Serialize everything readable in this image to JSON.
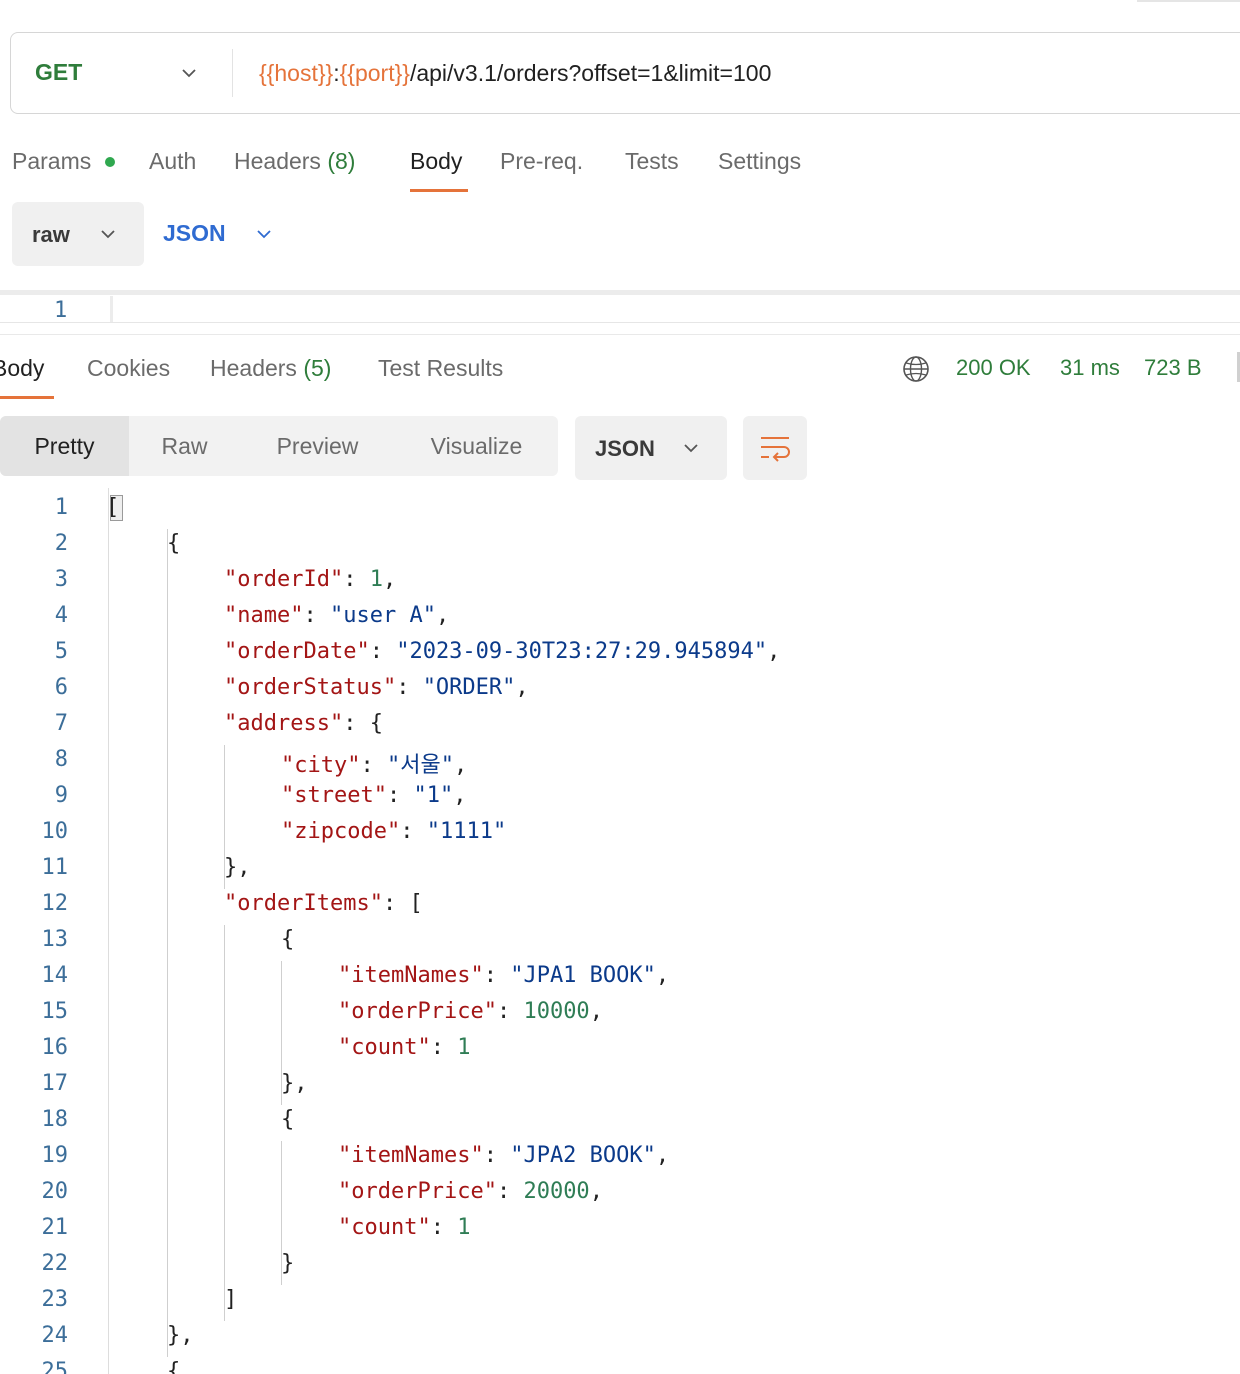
{
  "request": {
    "method": "GET",
    "url_parts": {
      "host_var": "{{host}}",
      "sep": ":",
      "port_var": "{{port}}",
      "path": "/api/v3.1/orders?offset=1&limit=100"
    },
    "tabs": [
      {
        "label": "Params"
      },
      {
        "label": "Auth"
      },
      {
        "label": "Headers",
        "count": "(8)"
      },
      {
        "label": "Body"
      },
      {
        "label": "Pre-req."
      },
      {
        "label": "Tests"
      },
      {
        "label": "Settings"
      }
    ],
    "active_tab": "Body",
    "body_mode": "raw",
    "body_format": "JSON",
    "editor_line": "1"
  },
  "response": {
    "tabs": [
      {
        "label": "Body"
      },
      {
        "label": "Cookies"
      },
      {
        "label": "Headers",
        "count": "(5)"
      },
      {
        "label": "Test Results"
      }
    ],
    "status": "200 OK",
    "time": "31 ms",
    "size": "723 B",
    "views": [
      "Pretty",
      "Raw",
      "Preview",
      "Visualize"
    ],
    "active_view": "Pretty",
    "format": "JSON",
    "code_lines": [
      {
        "n": "1",
        "indent": 0,
        "tokens": [
          [
            "p",
            "["
          ]
        ]
      },
      {
        "n": "2",
        "indent": 1,
        "tokens": [
          [
            "p",
            "{"
          ]
        ]
      },
      {
        "n": "3",
        "indent": 2,
        "tokens": [
          [
            "k",
            "\"orderId\""
          ],
          [
            "p",
            ": "
          ],
          [
            "n",
            "1"
          ],
          [
            "p",
            ","
          ]
        ]
      },
      {
        "n": "4",
        "indent": 2,
        "tokens": [
          [
            "k",
            "\"name\""
          ],
          [
            "p",
            ": "
          ],
          [
            "s",
            "\"user A\""
          ],
          [
            "p",
            ","
          ]
        ]
      },
      {
        "n": "5",
        "indent": 2,
        "tokens": [
          [
            "k",
            "\"orderDate\""
          ],
          [
            "p",
            ": "
          ],
          [
            "s",
            "\"2023-09-30T23:27:29.945894\""
          ],
          [
            "p",
            ","
          ]
        ]
      },
      {
        "n": "6",
        "indent": 2,
        "tokens": [
          [
            "k",
            "\"orderStatus\""
          ],
          [
            "p",
            ": "
          ],
          [
            "s",
            "\"ORDER\""
          ],
          [
            "p",
            ","
          ]
        ]
      },
      {
        "n": "7",
        "indent": 2,
        "tokens": [
          [
            "k",
            "\"address\""
          ],
          [
            "p",
            ": {"
          ]
        ]
      },
      {
        "n": "8",
        "indent": 3,
        "tokens": [
          [
            "k",
            "\"city\""
          ],
          [
            "p",
            ": "
          ],
          [
            "s",
            "\"서울\""
          ],
          [
            "p",
            ","
          ]
        ]
      },
      {
        "n": "9",
        "indent": 3,
        "tokens": [
          [
            "k",
            "\"street\""
          ],
          [
            "p",
            ": "
          ],
          [
            "s",
            "\"1\""
          ],
          [
            "p",
            ","
          ]
        ]
      },
      {
        "n": "10",
        "indent": 3,
        "tokens": [
          [
            "k",
            "\"zipcode\""
          ],
          [
            "p",
            ": "
          ],
          [
            "s",
            "\"1111\""
          ]
        ]
      },
      {
        "n": "11",
        "indent": 2,
        "tokens": [
          [
            "p",
            "},"
          ]
        ]
      },
      {
        "n": "12",
        "indent": 2,
        "tokens": [
          [
            "k",
            "\"orderItems\""
          ],
          [
            "p",
            ": ["
          ]
        ]
      },
      {
        "n": "13",
        "indent": 3,
        "tokens": [
          [
            "p",
            "{"
          ]
        ]
      },
      {
        "n": "14",
        "indent": 4,
        "tokens": [
          [
            "k",
            "\"itemNames\""
          ],
          [
            "p",
            ": "
          ],
          [
            "s",
            "\"JPA1 BOOK\""
          ],
          [
            "p",
            ","
          ]
        ]
      },
      {
        "n": "15",
        "indent": 4,
        "tokens": [
          [
            "k",
            "\"orderPrice\""
          ],
          [
            "p",
            ": "
          ],
          [
            "n",
            "10000"
          ],
          [
            "p",
            ","
          ]
        ]
      },
      {
        "n": "16",
        "indent": 4,
        "tokens": [
          [
            "k",
            "\"count\""
          ],
          [
            "p",
            ": "
          ],
          [
            "n",
            "1"
          ]
        ]
      },
      {
        "n": "17",
        "indent": 3,
        "tokens": [
          [
            "p",
            "},"
          ]
        ]
      },
      {
        "n": "18",
        "indent": 3,
        "tokens": [
          [
            "p",
            "{"
          ]
        ]
      },
      {
        "n": "19",
        "indent": 4,
        "tokens": [
          [
            "k",
            "\"itemNames\""
          ],
          [
            "p",
            ": "
          ],
          [
            "s",
            "\"JPA2 BOOK\""
          ],
          [
            "p",
            ","
          ]
        ]
      },
      {
        "n": "20",
        "indent": 4,
        "tokens": [
          [
            "k",
            "\"orderPrice\""
          ],
          [
            "p",
            ": "
          ],
          [
            "n",
            "20000"
          ],
          [
            "p",
            ","
          ]
        ]
      },
      {
        "n": "21",
        "indent": 4,
        "tokens": [
          [
            "k",
            "\"count\""
          ],
          [
            "p",
            ": "
          ],
          [
            "n",
            "1"
          ]
        ]
      },
      {
        "n": "22",
        "indent": 3,
        "tokens": [
          [
            "p",
            "}"
          ]
        ]
      },
      {
        "n": "23",
        "indent": 2,
        "tokens": [
          [
            "p",
            "]"
          ]
        ]
      },
      {
        "n": "24",
        "indent": 1,
        "tokens": [
          [
            "p",
            "},"
          ]
        ]
      },
      {
        "n": "25",
        "indent": 1,
        "tokens": [
          [
            "p",
            "{"
          ]
        ]
      }
    ]
  },
  "colors": {
    "accent": "#e5733a",
    "status_green": "#2f7d3b",
    "json_key": "#a31515",
    "json_string": "#0b3a8a",
    "json_number": "#2f7d55",
    "line_number": "#3c6e99"
  }
}
